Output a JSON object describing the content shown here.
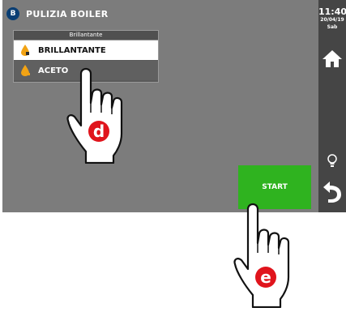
{
  "header": {
    "app_badge_letter": "B",
    "title": "PULIZIA BOILER"
  },
  "clock": {
    "time": "11:40",
    "date": "20/04/19",
    "day": "Sab"
  },
  "dropdown": {
    "header": "Brillantante",
    "options": [
      {
        "label": "BRILLANTANTE",
        "selected": true,
        "icon": "drop-icon"
      },
      {
        "label": "ACETO",
        "selected": false,
        "icon": "drop-icon"
      }
    ]
  },
  "sidebar": {
    "buttons": [
      "home-icon",
      "lightbulb-icon",
      "back-icon"
    ]
  },
  "start_button": {
    "label": "START"
  },
  "annotations": [
    {
      "label": "d"
    },
    {
      "label": "e"
    }
  ],
  "colors": {
    "screen_bg": "#7c7c7c",
    "sidebar_bg": "#454545",
    "start_green": "#2fb31f",
    "badge_red": "#e0141c",
    "app_badge_blue": "#0a3e73",
    "drop_orange": "#f2a314"
  }
}
